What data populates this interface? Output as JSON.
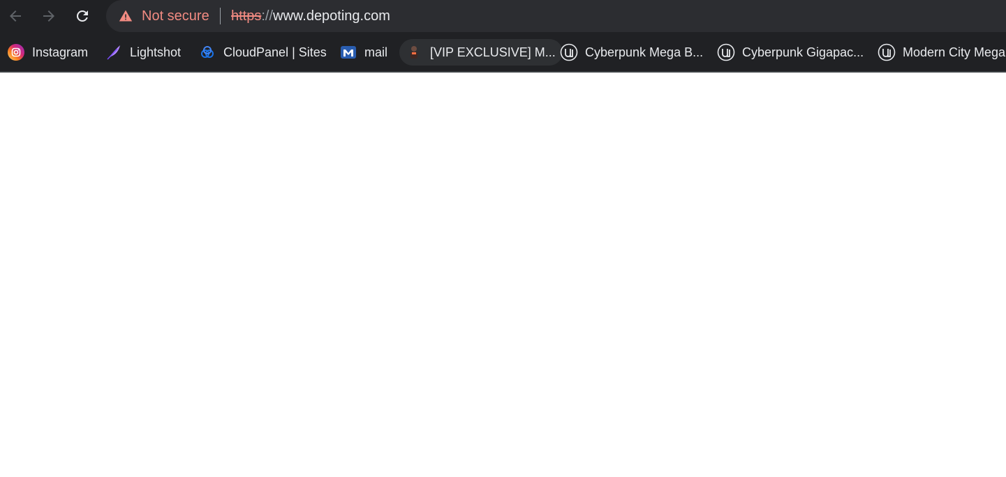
{
  "toolbar": {
    "back_icon": "arrow-left-icon",
    "forward_icon": "arrow-right-icon",
    "reload_icon": "reload-icon"
  },
  "omnibox": {
    "security_icon": "warning-triangle-icon",
    "security_label": "Not secure",
    "url_scheme": "https",
    "url_slashes": "://",
    "url_host": "www.depoting.com",
    "warning_color": "#f28b82"
  },
  "bookmarks": [
    {
      "label": "Instagram",
      "icon": "instagram-icon"
    },
    {
      "label": "Lightshot",
      "icon": "feather-icon"
    },
    {
      "label": "CloudPanel | Sites",
      "icon": "cloud-icon"
    },
    {
      "label": "mail",
      "icon": "mail-m-icon"
    },
    {
      "label": "[VIP EXCLUSIVE] M...",
      "icon": "character-avatar-icon"
    },
    {
      "label": "Cyberpunk Mega B...",
      "icon": "unreal-engine-icon"
    },
    {
      "label": "Cyberpunk Gigapac...",
      "icon": "unreal-engine-icon"
    },
    {
      "label": "Modern City Mega",
      "icon": "unreal-engine-icon"
    }
  ],
  "colors": {
    "chrome_bg": "#202124",
    "omnibox_bg": "#2c2d31",
    "text": "#e8eaed",
    "page_bg": "#ffffff"
  }
}
